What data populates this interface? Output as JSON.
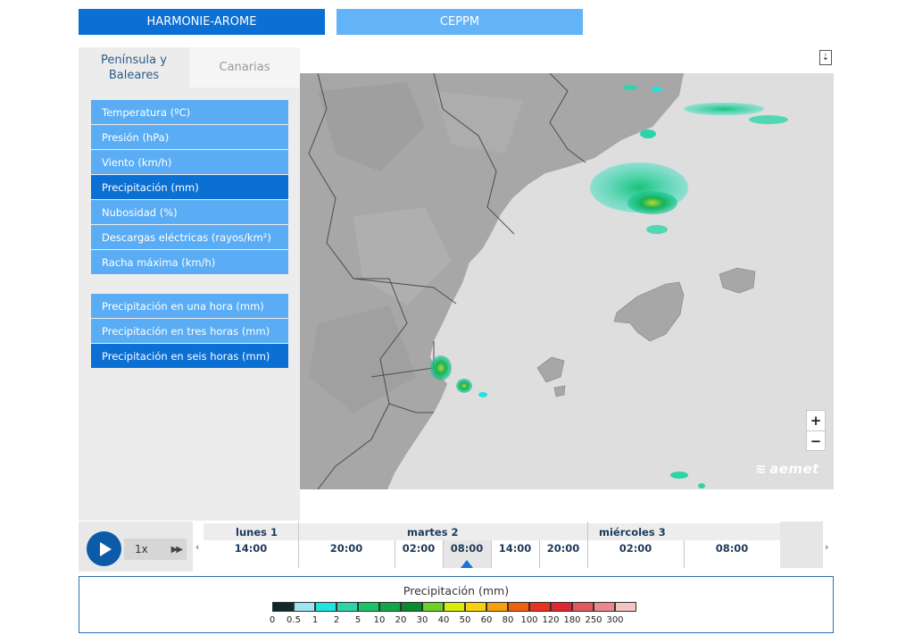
{
  "models": {
    "harmonie": "HARMONIE-AROME",
    "ceppm": "CEPPM"
  },
  "regions": {
    "peninsula": "Península y\nBaleares",
    "canarias": "Canarias"
  },
  "variables": [
    "Temperatura (ºC)",
    "Presión (hPa)",
    "Viento (km/h)",
    "Precipitación (mm)",
    "Nubosidad (%)",
    "Descargas eléctricas (rayos/km²)",
    "Racha máxima (km/h)"
  ],
  "selected_variable": "Precipitación (mm)",
  "precip_options": [
    "Precipitación en una hora (mm)",
    "Precipitación en tres horas (mm)",
    "Precipitación en seis horas (mm)"
  ],
  "selected_precip_option": "Precipitación en seis horas (mm)",
  "map": {
    "zoom_in": "+",
    "zoom_out": "−",
    "logo": "aemet",
    "download_icon": "download-icon"
  },
  "player": {
    "speed": "1x",
    "play_icon": "play-icon",
    "ff_icon": "fast-forward-icon",
    "prev": "‹",
    "next": "›"
  },
  "timeline": {
    "days": [
      "lunes 1",
      "martes 2",
      "miércoles 3"
    ],
    "hours": [
      "14:00",
      "20:00",
      "02:00",
      "08:00",
      "14:00",
      "20:00",
      "02:00",
      "08:00"
    ],
    "current_hour": "08:00"
  },
  "legend": {
    "title": "Precipitación (mm)",
    "ticks": [
      "0",
      "0.5",
      "1",
      "2",
      "5",
      "10",
      "20",
      "30",
      "40",
      "50",
      "60",
      "80",
      "100",
      "120",
      "180",
      "250",
      "300"
    ],
    "colors": [
      "#0e2a2a",
      "#9fe5ef",
      "#22e3e0",
      "#2ed3a8",
      "#19c468",
      "#13a54a",
      "#0b8a2e",
      "#6ccf2a",
      "#d9ea11",
      "#f5d20f",
      "#f79f0c",
      "#f0620f",
      "#e6321f",
      "#e02632",
      "#e1585e",
      "#e9898c",
      "#f3c5c4"
    ]
  }
}
